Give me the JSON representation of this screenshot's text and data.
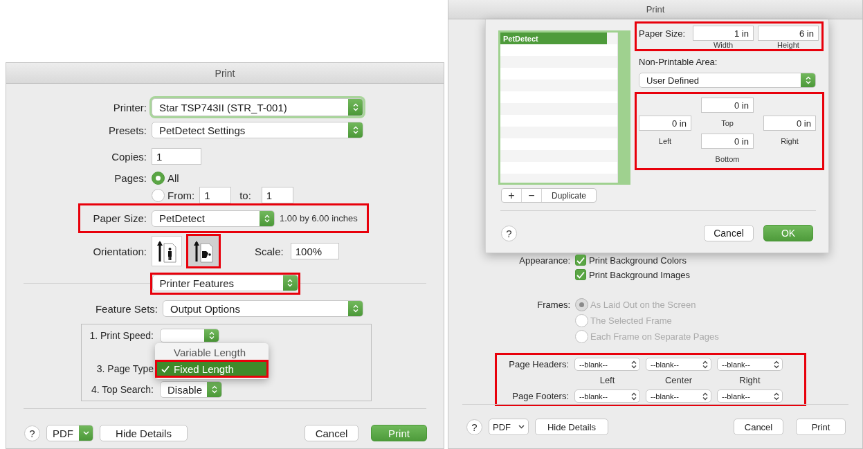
{
  "left_dialog": {
    "title": "Print",
    "printer": {
      "label": "Printer:",
      "value": "Star TSP743II (STR_T-001)",
      "focused": true
    },
    "presets": {
      "label": "Presets:",
      "value": "PetDetect Settings"
    },
    "copies": {
      "label": "Copies:",
      "value": "1"
    },
    "pages": {
      "label": "Pages:",
      "options": [
        {
          "label": "All",
          "selected": true
        },
        {
          "label": "From:",
          "selected": false
        }
      ],
      "from": "1",
      "to_label": "to:",
      "to": "1"
    },
    "paper_size": {
      "label": "Paper Size:",
      "value": "PetDetect",
      "description": "1.00 by 6.00 inches",
      "highlighted": true
    },
    "orientation": {
      "label": "Orientation:",
      "options": [
        {
          "kind": "portrait",
          "selected": false,
          "highlighted": false
        },
        {
          "kind": "landscape",
          "selected": true,
          "highlighted": true
        }
      ]
    },
    "scale": {
      "label": "Scale:",
      "value": "100%"
    },
    "panel_menu": {
      "value": "Printer Features",
      "highlighted": true
    },
    "feature_sets": {
      "label": "Feature Sets:",
      "value": "Output Options"
    },
    "features": [
      {
        "label": "1. Print Speed:"
      },
      {
        "label": "3. Page Type"
      },
      {
        "label": "4. Top Search:",
        "value": "Disable"
      }
    ],
    "popup_menu": [
      {
        "label": "Variable Length",
        "selected": false,
        "highlighted": false
      },
      {
        "label": "Fixed Length",
        "selected": true,
        "highlighted": true
      }
    ],
    "footer": {
      "help": "?",
      "pdf": "PDF",
      "pdf_accent": true,
      "buttons": [
        {
          "label": "Hide Details",
          "default": false
        },
        {
          "label": "Cancel",
          "default": false
        },
        {
          "label": "Print",
          "default": true
        }
      ]
    }
  },
  "right_dialog": {
    "title": "Print",
    "sheet": {
      "sizes": [
        {
          "label": "PetDetect",
          "selected": true
        }
      ],
      "list_focused": true,
      "list_buttons": [
        "+",
        "−",
        "Duplicate"
      ],
      "paper_size": {
        "label": "Paper Size:",
        "width": "1 in",
        "width_label": "Width",
        "height": "6 in",
        "height_label": "Height",
        "highlighted": true
      },
      "non_printable": {
        "label": "Non-Printable Area:",
        "value": "User Defined"
      },
      "margins": {
        "highlighted": true,
        "top": "0 in",
        "top_label": "Top",
        "left": "0 in",
        "left_label": "Left",
        "right": "0 in",
        "right_label": "Right",
        "bottom": "0 in",
        "bottom_label": "Bottom"
      },
      "help": "?",
      "buttons": [
        {
          "label": "Cancel",
          "default": false
        },
        {
          "label": "OK",
          "default": true
        }
      ]
    },
    "appearance": {
      "label": "Appearance:",
      "options": [
        {
          "label": "Print Background Colors",
          "checked": true
        },
        {
          "label": "Print Background Images",
          "checked": true
        }
      ]
    },
    "frames": {
      "label": "Frames:",
      "disabled": true,
      "options": [
        {
          "label": "As Laid Out on the Screen",
          "selected": true
        },
        {
          "label": "The Selected Frame",
          "selected": false
        },
        {
          "label": "Each Frame on Separate Pages",
          "selected": false
        }
      ]
    },
    "headers_footers": {
      "highlighted": true,
      "headers_label": "Page Headers:",
      "headers": [
        "--blank--",
        "--blank--",
        "--blank--"
      ],
      "columns": [
        "Left",
        "Center",
        "Right"
      ],
      "footers_label": "Page Footers:",
      "footers": [
        "--blank--",
        "--blank--",
        "--blank--"
      ]
    },
    "footer": {
      "help": "?",
      "pdf": "PDF",
      "pdf_accent": false,
      "buttons": [
        {
          "label": "Hide Details",
          "default": false
        },
        {
          "label": "Cancel",
          "default": false
        },
        {
          "label": "Print",
          "default": false
        }
      ]
    }
  }
}
